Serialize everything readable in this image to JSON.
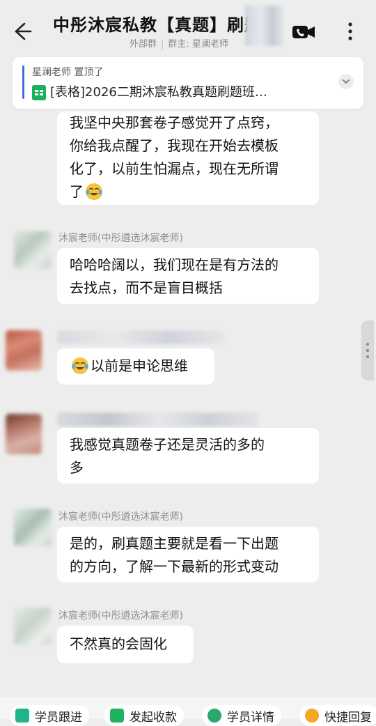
{
  "header": {
    "title": "中彤沐宸私教【真题】刷题",
    "group_type": "外部群",
    "owner_label": "群主: 星澜老师"
  },
  "pinned": {
    "author_line": "星澜老师 置顶了",
    "file_text": "[表格]2026二期沐宸私教真题刷题班…"
  },
  "messages": [
    {
      "sender": "",
      "lines": [
        "我坚中央那套卷子感觉开了点窍，",
        "你给我点醒了，我现在开始去模板",
        "化了，以前生怕漏点，现在无所谓",
        "了"
      ],
      "emoji_end": "laugh-cry-emoji"
    },
    {
      "sender": "沐宸老师(中彤遴选沐宸老师)",
      "lines": [
        "哈哈哈阔以，我们现在是有方法的",
        "去找点，而不是盲目概括"
      ]
    },
    {
      "sender": "",
      "lines": [
        "以前是申论思维"
      ],
      "emoji_start": "laugh-cry-emoji"
    },
    {
      "sender": "",
      "lines": [
        "我感觉真题卷子还是灵活的多的",
        "多"
      ]
    },
    {
      "sender": "沐宸老师(中彤遴选沐宸老师)",
      "lines": [
        "是的，刷真题主要就是看一下出题",
        "的方向，了解一下最新的形式变动"
      ]
    },
    {
      "sender": "沐宸老师(中彤遴选沐宸老师)",
      "lines": [
        "不然真的会固化"
      ]
    }
  ],
  "bottom_bar": {
    "chips": [
      {
        "label": "学员跟进",
        "icon": "follow-up-icon",
        "color": "#1fb58a"
      },
      {
        "label": "发起收款",
        "icon": "payment-icon",
        "color": "#20b35e"
      },
      {
        "label": "学员详情",
        "icon": "student-detail-icon",
        "color": "#2aa86a"
      },
      {
        "label": "快捷回复",
        "icon": "quick-reply-icon",
        "color": "#f5a623"
      }
    ]
  },
  "colors": {
    "background": "#ededed",
    "bubble": "#ffffff",
    "pin_accent": "#3a6fd6",
    "sheet_icon": "#1bb15a"
  }
}
